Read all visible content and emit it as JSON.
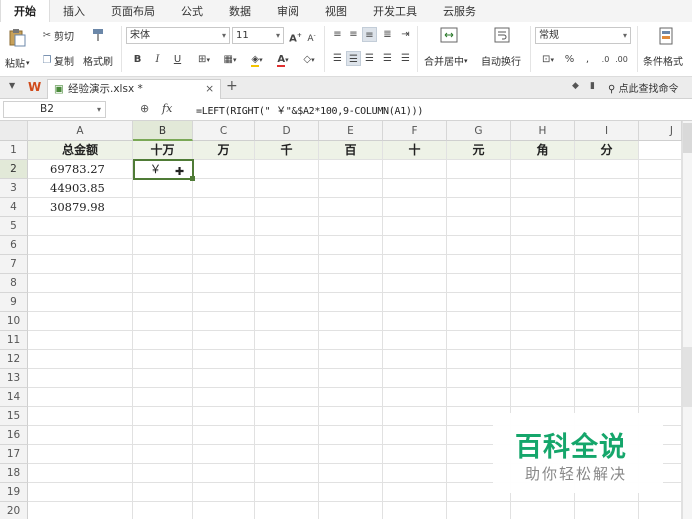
{
  "menu": [
    "开始",
    "插入",
    "页面布局",
    "公式",
    "数据",
    "审阅",
    "视图",
    "开发工具",
    "云服务"
  ],
  "ribbon": {
    "paste": "粘贴",
    "cut": "剪切",
    "copy": "复制",
    "format_painter": "格式刷",
    "font_name": "宋体",
    "font_size": "11",
    "bold": "B",
    "italic": "I",
    "underline": "U",
    "grow_font": "A",
    "shrink_font": "A",
    "merge_center": "合并居中",
    "wrap_text": "自动换行",
    "number_format": "常规",
    "conditional_format": "条件格式"
  },
  "doc_tab": {
    "name": "经验演示.xlsx *",
    "close": "×",
    "add": "+"
  },
  "tabbar_right": {
    "find": "点此查找命令"
  },
  "formula_bar": {
    "name_box": "B2",
    "fx": "fx",
    "formula": "=LEFT(RIGHT(\" ￥\"&$A2*100,9-COLUMN(A1)))"
  },
  "columns": [
    "A",
    "B",
    "C",
    "D",
    "E",
    "F",
    "G",
    "H",
    "I",
    "J"
  ],
  "rows": [
    "1",
    "2",
    "3",
    "4",
    "5",
    "6",
    "7",
    "8",
    "9",
    "10",
    "11",
    "12",
    "13",
    "14",
    "15",
    "16",
    "17",
    "18",
    "19",
    "20"
  ],
  "header_row": [
    "总金额",
    "十万",
    "万",
    "千",
    "百",
    "十",
    "元",
    "角",
    "分"
  ],
  "amounts": [
    "69783.27",
    "44903.85",
    "30879.98"
  ],
  "b2_value": "￥",
  "watermark": {
    "title": "百科全说",
    "subtitle": "助你轻松解决"
  },
  "colors": {
    "accent": "#4f7b36",
    "header_fill": "#eef2e7",
    "watermark": "#15a66b"
  }
}
